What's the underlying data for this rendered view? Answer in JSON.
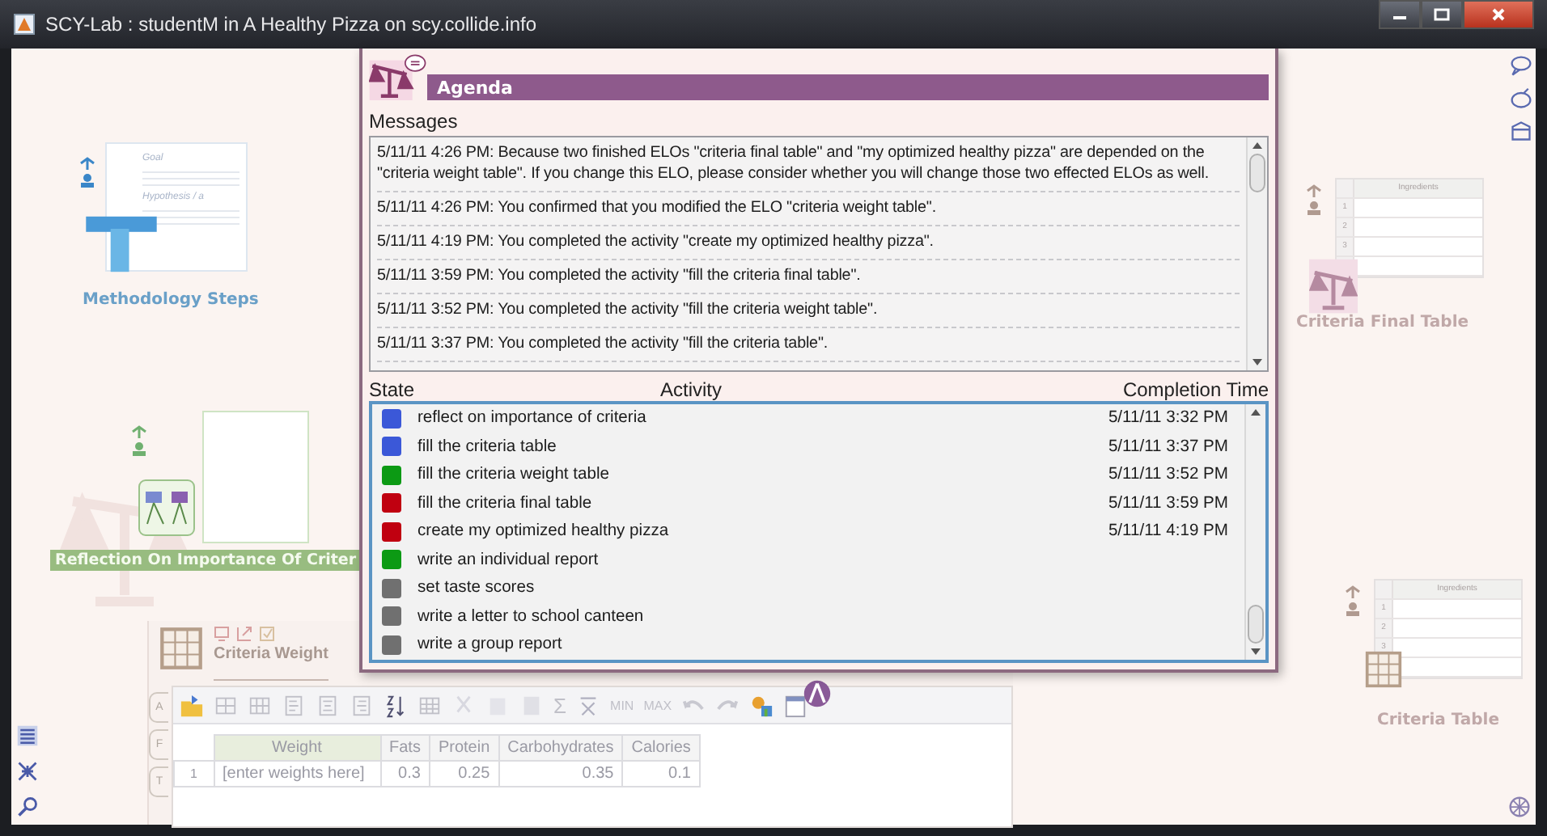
{
  "window": {
    "title": "SCY-Lab : studentM in A Healthy Pizza on scy.collide.info"
  },
  "desktop_items": [
    {
      "kind": "methodology",
      "label": "Methodology Steps",
      "texts": [
        "Goal",
        "Hypothesis / a"
      ]
    },
    {
      "kind": "reflection",
      "label": "Reflection On Importance Of Criter"
    },
    {
      "kind": "table",
      "label": "Criteria Final Table",
      "header": "Ingredients",
      "rows": [
        "1",
        "2",
        "3"
      ]
    },
    {
      "kind": "table",
      "label": "Criteria Table",
      "header": "Ingredients",
      "rows": [
        "1",
        "2",
        "3"
      ]
    }
  ],
  "agenda": {
    "title": "Agenda",
    "messages_label": "Messages",
    "messages": [
      "5/11/11 4:26 PM: Because two finished  ELOs \"criteria final table\" and \"my optimized healthy pizza\" are depended on the \"criteria weight table\". If you change this ELO, please consider whether you will change those two effected ELOs as well.",
      "5/11/11 4:26 PM: You confirmed that you modified the ELO \"criteria weight table\".",
      "5/11/11 4:19 PM: You completed the activity \"create my optimized healthy pizza\".",
      "5/11/11 3:59 PM: You completed the activity \"fill the criteria final table\".",
      "5/11/11 3:52 PM: You completed the activity \"fill the criteria weight table\".",
      "5/11/11 3:37 PM: You completed the activity \"fill the criteria table\"."
    ],
    "columns": [
      "State",
      "Activity",
      "Completion Time"
    ],
    "activities": [
      {
        "color": "#3b58d8",
        "name": "reflect on importance of criteria",
        "time": "5/11/11 3:32 PM"
      },
      {
        "color": "#3b58d8",
        "name": "fill the criteria table",
        "time": "5/11/11 3:37 PM"
      },
      {
        "color": "#0c9a14",
        "name": "fill the criteria weight table",
        "time": "5/11/11 3:52 PM"
      },
      {
        "color": "#c00010",
        "name": "fill the criteria final table",
        "time": "5/11/11 3:59 PM"
      },
      {
        "color": "#c00010",
        "name": "create my optimized healthy pizza",
        "time": "5/11/11 4:19 PM"
      },
      {
        "color": "#0c9a14",
        "name": "write an individual report"
      },
      {
        "color": "#707070",
        "name": "set taste scores"
      },
      {
        "color": "#707070",
        "name": "write a letter to school canteen"
      },
      {
        "color": "#707070",
        "name": "write a group report"
      }
    ]
  },
  "editor": {
    "title": "Criteria Weight",
    "side_tabs": [
      "A",
      "F",
      "T"
    ],
    "toolbar_texts": [
      "Σ",
      "MIN",
      "MAX"
    ],
    "columns": [
      "",
      "Weight",
      "Fats",
      "Protein",
      "Carbohydrates",
      "Calories"
    ],
    "rows": [
      [
        "1",
        "[enter weights here]",
        "0.3",
        "0.25",
        "0.35",
        "0.1"
      ]
    ]
  }
}
